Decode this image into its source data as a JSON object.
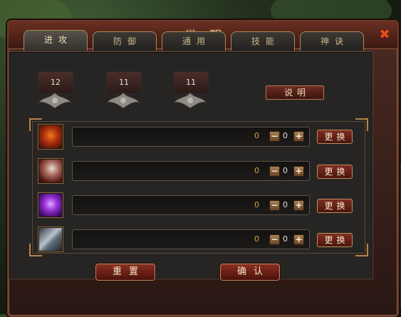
{
  "window": {
    "title": "觉醒",
    "close_glyph": "✖"
  },
  "tabs": [
    {
      "label": "进攻",
      "active": true
    },
    {
      "label": "防御",
      "active": false
    },
    {
      "label": "通用",
      "active": false
    },
    {
      "label": "技能",
      "active": false
    },
    {
      "label": "神诀",
      "active": false
    }
  ],
  "counters": [
    "12",
    "11",
    "11"
  ],
  "explain_button": "说明",
  "rows": [
    {
      "icon": "fire-warrior-icon",
      "value": "0",
      "count": "0",
      "change_label": "更换"
    },
    {
      "icon": "skull-mask-icon",
      "value": "0",
      "count": "0",
      "change_label": "更换"
    },
    {
      "icon": "purple-magic-icon",
      "value": "0",
      "count": "0",
      "change_label": "更换"
    },
    {
      "icon": "blade-icon",
      "value": "0",
      "count": "0",
      "change_label": "更换"
    }
  ],
  "stepper": {
    "minus": "−",
    "plus": "+"
  },
  "footer": {
    "reset_label": "重置",
    "confirm_label": "确认"
  },
  "colors": {
    "accent_red": "#7e2d22",
    "gold": "#b78f5f",
    "value_text": "#d6a33c"
  }
}
